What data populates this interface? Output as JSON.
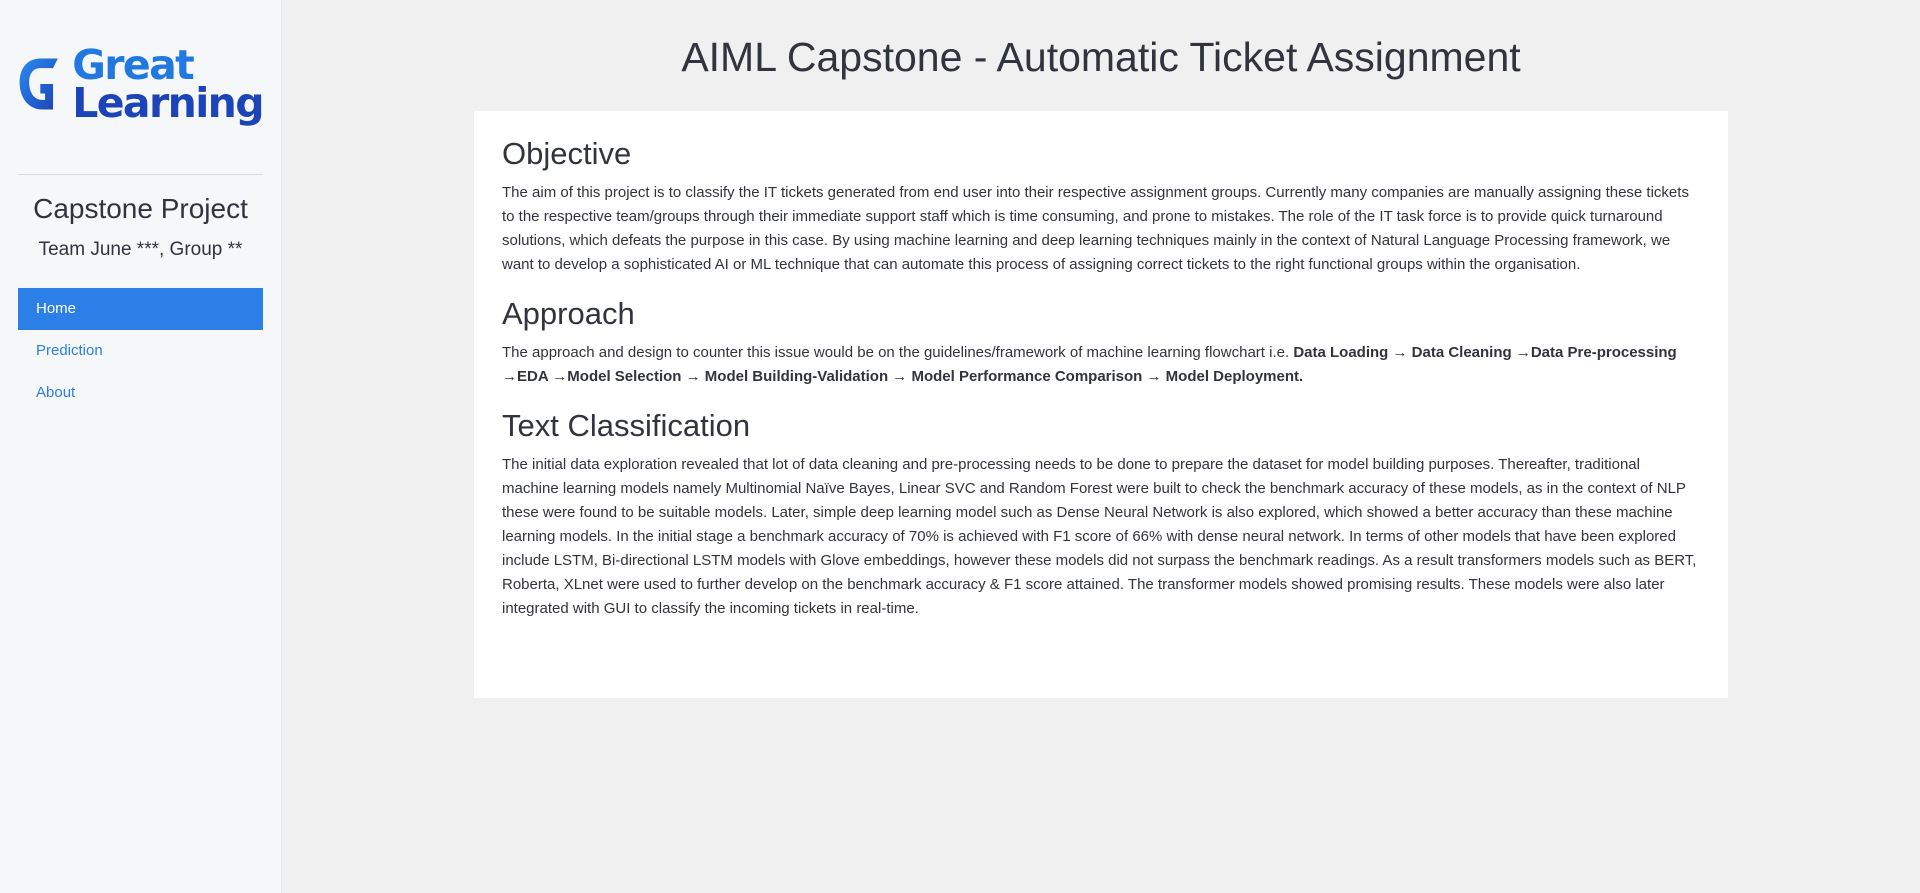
{
  "sidebar": {
    "logo": {
      "line1": "Great",
      "line2": "Learning",
      "colors": {
        "light": "#2078e0",
        "dark": "#1b44b8"
      }
    },
    "project_title": "Capstone Project",
    "team_line": "Team June ***, Group **",
    "nav": [
      {
        "label": "Home",
        "active": true
      },
      {
        "label": "Prediction",
        "active": false
      },
      {
        "label": "About",
        "active": false
      }
    ]
  },
  "main": {
    "title": "AIML Capstone - Automatic Ticket Assignment",
    "sections": {
      "objective": {
        "heading": "Objective",
        "text": "The aim of this project is to classify the IT tickets generated from end user into their respective assignment groups. Currently many companies are manually assigning these tickets to the respective team/groups through their immediate support staff which is time consuming, and prone to mistakes. The role of the IT task force is to provide quick turnaround solutions, which defeats the purpose in this case. By using machine learning and deep learning techniques mainly in the context of Natural Language Processing framework, we want to develop a sophisticated AI or ML technique that can automate this process of assigning correct tickets to the right functional groups within the organisation."
      },
      "approach": {
        "heading": "Approach",
        "intro": "The approach and design to counter this issue would be on the guidelines/framework of machine learning flowchart i.e.",
        "steps": "Data Loading → Data Cleaning →Data Pre-processing →EDA →Model Selection → Model Building-Validation → Model Performance Comparison → Model Deployment."
      },
      "text_classification": {
        "heading": "Text Classification",
        "text": "The initial data exploration revealed that lot of data cleaning and pre-processing needs to be done to prepare the dataset for model building purposes. Thereafter, traditional machine learning models namely Multinomial Naïve Bayes, Linear SVC and Random Forest were built to check the benchmark accuracy of these models, as in the context of NLP these were found to be suitable models. Later, simple deep learning model such as Dense Neural Network is also explored, which showed a better accuracy than these machine learning models. In the initial stage a benchmark accuracy of 70% is achieved with F1 score of 66% with dense neural network. In terms of other models that have been explored include LSTM, Bi-directional LSTM models with Glove embeddings, however these models did not surpass the benchmark readings. As a result transformers models such as BERT, Roberta, XLnet were used to further develop on the benchmark accuracy & F1 score attained. The transformer models showed promising results. These models were also later integrated with GUI to classify the incoming tickets in real-time."
      }
    }
  },
  "colors": {
    "accent": "#2b7fe6",
    "sidebar_bg": "#f6f7f9",
    "main_bg": "#f0f0f0",
    "card_bg": "#ffffff",
    "text": "#31333f"
  }
}
